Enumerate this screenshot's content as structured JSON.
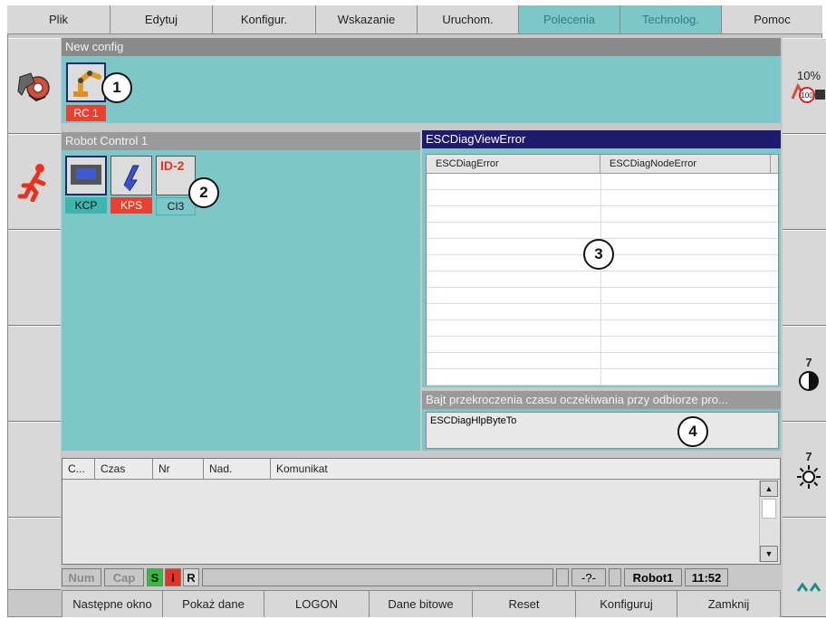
{
  "menu": [
    "Plik",
    "Edytuj",
    "Konfigur.",
    "Wskazanie",
    "Uruchom.",
    "Polecenia",
    "Technolog.",
    "Pomoc"
  ],
  "config_panel": {
    "title": "New config",
    "rc_label": "RC 1",
    "callout": "1"
  },
  "robot_control": {
    "title": "Robot Control 1",
    "modules": [
      {
        "tag": "KCP",
        "tag_color": "#3fb5b0"
      },
      {
        "tag": "KPS",
        "tag_color": "#e8412f"
      },
      {
        "tag": "CI3",
        "tag_color": "#7ec7c9",
        "id_label": "ID-2"
      }
    ],
    "callout": "2"
  },
  "error_view": {
    "title": "ESCDiagViewError",
    "columns": [
      "ESCDiagError",
      "ESCDiagNodeError"
    ],
    "callout": "3"
  },
  "info_panel": {
    "title": "Bajt przekroczenia czasu oczekiwania przy odbiorze pro...",
    "value": "ESCDiagHlpByteTo",
    "callout": "4"
  },
  "messages": {
    "columns": [
      "C...",
      "Czas",
      "Nr",
      "Nad.",
      "Komunikat"
    ]
  },
  "status_bar": {
    "num": "Num",
    "cap": "Cap",
    "s": "S",
    "i": "I",
    "r": "R",
    "unknown": "-?-",
    "robot": "Robot1",
    "time": "11:52"
  },
  "right_panel": {
    "override": "10%",
    "speed_value": "7",
    "brightness_value": "7",
    "speed_badge": "100"
  },
  "softkeys": [
    "Następne okno",
    "Pokaż dane",
    "LOGON",
    "Dane bitowe",
    "Reset",
    "Konfiguruj",
    "Zamknij"
  ]
}
